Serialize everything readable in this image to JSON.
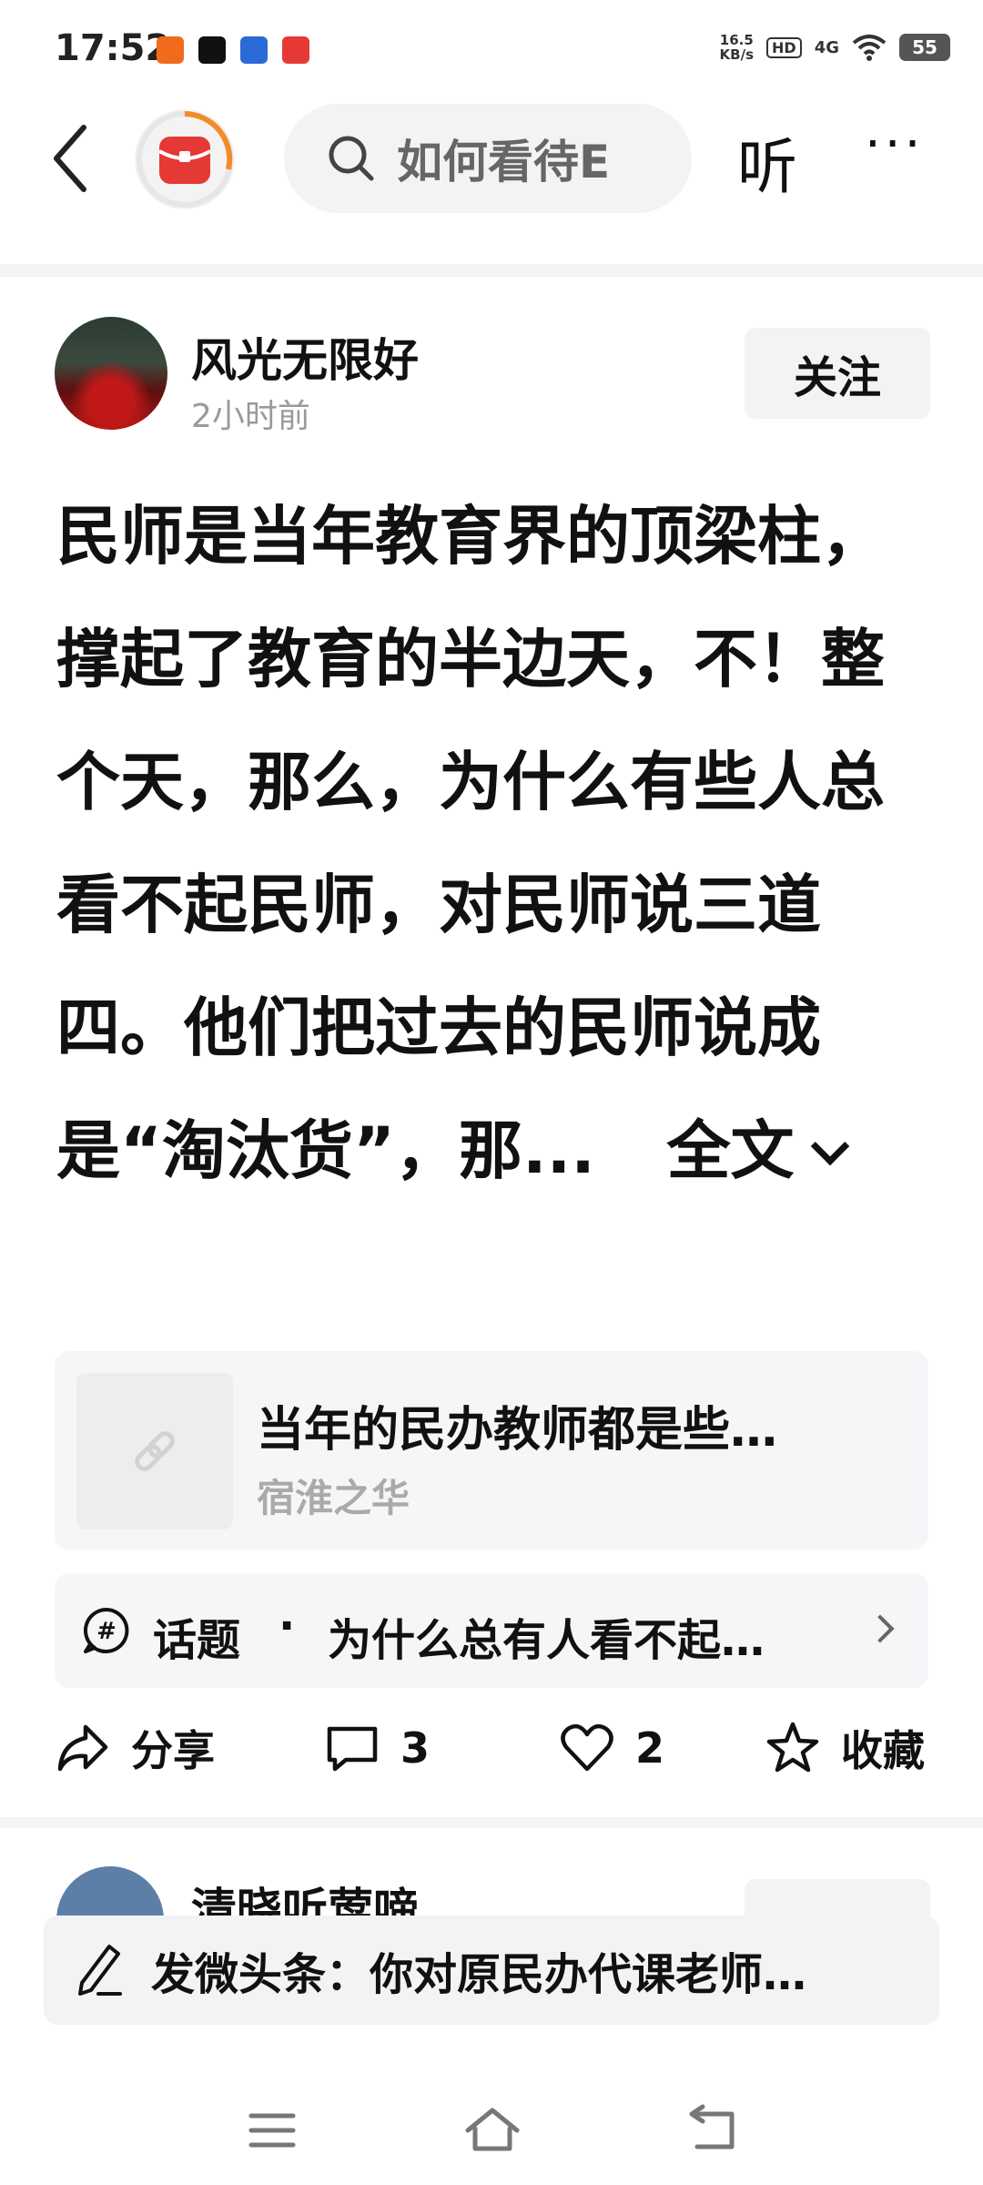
{
  "status_bar": {
    "time": "17:52",
    "net_speed_value": "16.5",
    "net_speed_unit": "KB/s",
    "hd_label": "HD",
    "signal_label": "4G",
    "battery": "55",
    "app_icons": [
      "red-app-icon",
      "tiktok-icon",
      "baidu-icon",
      "toutiao-icon"
    ]
  },
  "header": {
    "search_text": "如何看待E",
    "listen_label": "听",
    "more_label": "···"
  },
  "post": {
    "author": "风光无限好",
    "time": "2小时前",
    "follow_label": "关注",
    "body": "民师是当年教育界的顶梁柱，撑起了教育的半边天，不！整个天，那么，为什么有些人总看不起民师，对民师说三道四。他们把过去的民师说成是“淘汰货”，那...",
    "expand_label": "全文",
    "link_card": {
      "title": "当年的民办教师都是些…",
      "source": "宿淮之华"
    },
    "topic": {
      "label": "话题",
      "dot": "·",
      "title": "为什么总有人看不起…"
    },
    "actions": {
      "share": "分享",
      "comments": "3",
      "likes": "2",
      "favorite": "收藏"
    }
  },
  "next_post": {
    "author": "清晓听莺啼"
  },
  "compose": {
    "text": "发微头条：你对原民办代课老师…"
  },
  "colors": {
    "accent_orange": "#f28c28",
    "logo_red": "#e53935",
    "muted_gray": "#9a9a9a",
    "card_bg": "#f5f6f8"
  }
}
